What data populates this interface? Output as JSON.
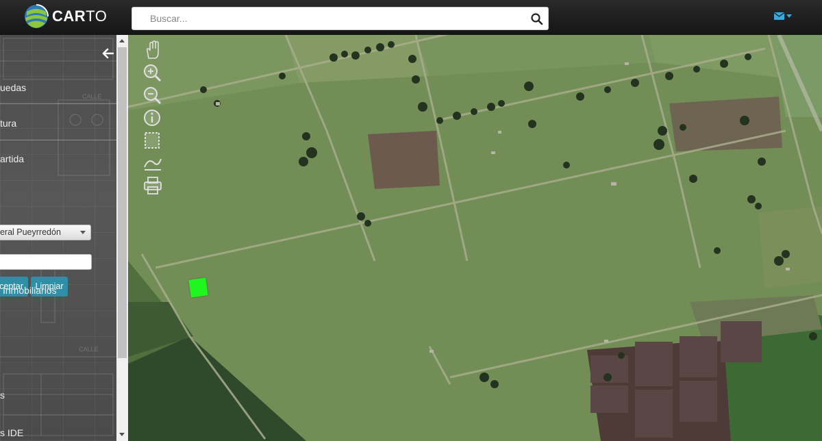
{
  "header": {
    "logo_text_bold": "CAR",
    "logo_text_light": "TO",
    "search_placeholder": "Buscar...",
    "mail_icon": "envelope-icon",
    "search_icon": "magnifier-icon"
  },
  "sidebar": {
    "back_icon": "arrow-left-icon",
    "items": [
      {
        "label": "uedas"
      },
      {
        "label": "tura"
      },
      {
        "label": "artida"
      },
      {
        "label": "Inmobiliarios"
      },
      {
        "label": "s"
      },
      {
        "label": "s IDE"
      }
    ],
    "partido_select": "neral Pueyrredón",
    "partida_input": "",
    "accept_label": "ceptar",
    "clear_label": "Limpiar"
  },
  "map": {
    "tools": [
      "pan-hand-icon",
      "zoom-in-icon",
      "zoom-out-icon",
      "info-icon",
      "select-rectangle-icon",
      "measure-icon",
      "print-icon"
    ],
    "colors": {
      "highlight": "#1ff51f",
      "button": "#2e8fa6",
      "accent": "#3aa8df"
    }
  }
}
